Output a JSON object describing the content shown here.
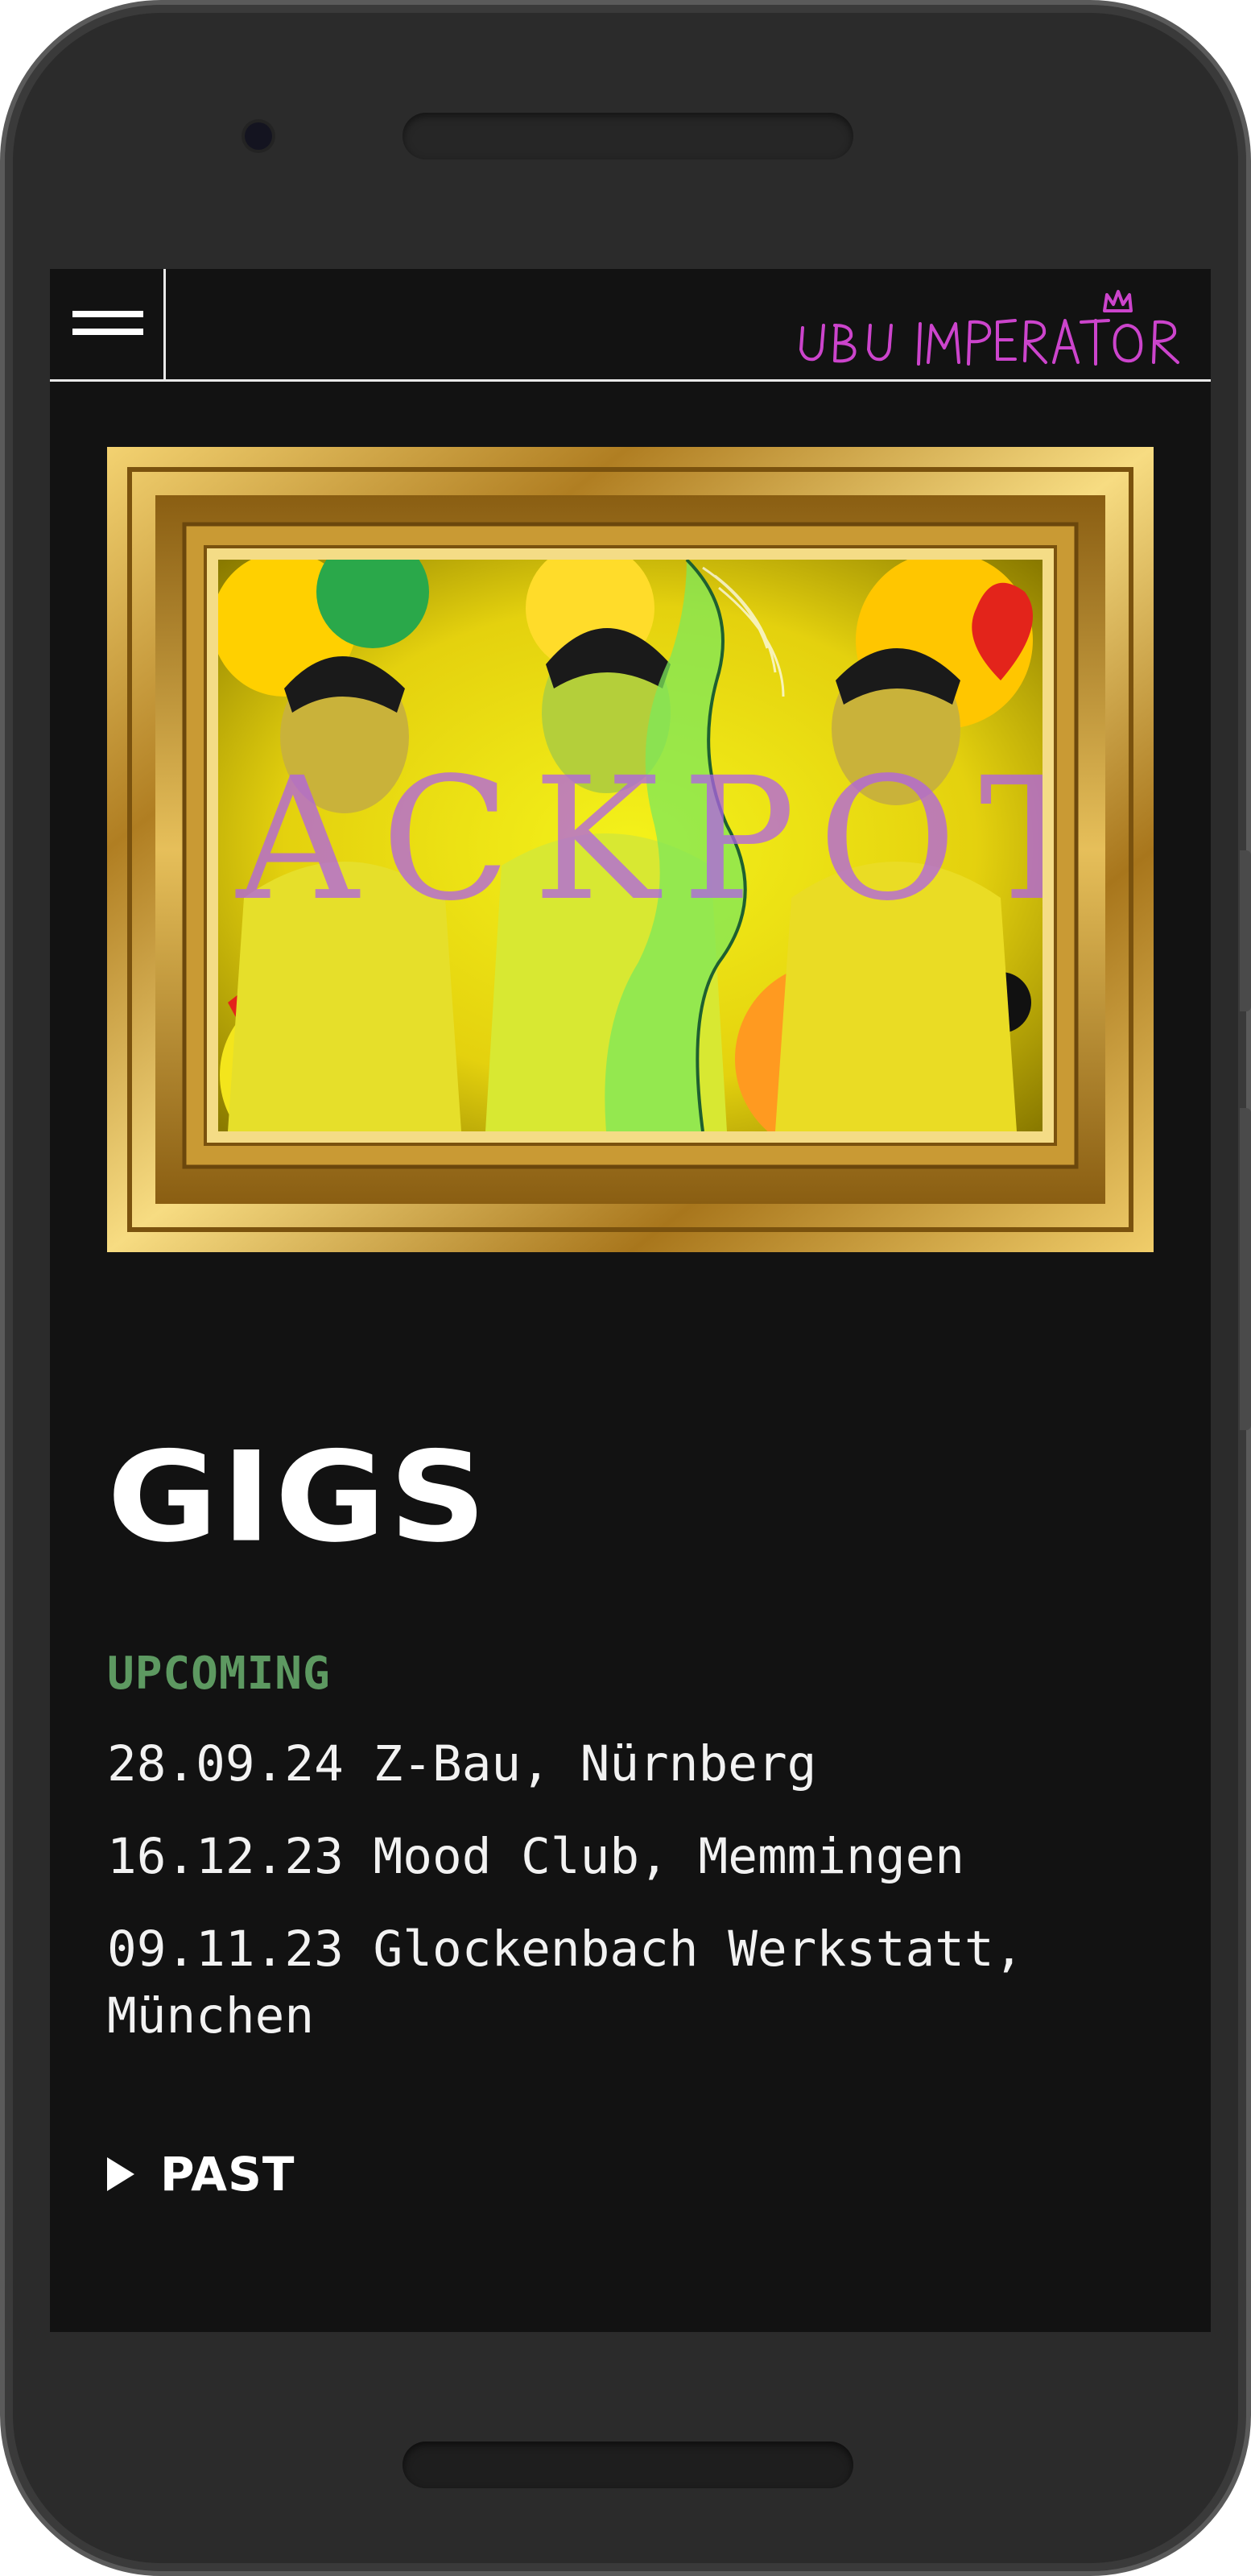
{
  "brand": {
    "logo_text": "UBU IMPERATOR",
    "logo_color": "#cc44cc"
  },
  "hero": {
    "overlay_text": "JACKPOT",
    "overlay_color": "#b060e8"
  },
  "gigs": {
    "title": "GIGS",
    "upcoming_label": "UPCOMING",
    "upcoming_color": "#5d9961",
    "items": [
      "28.09.24 Z-Bau, Nürnberg",
      "16.12.23 Mood Club, Memmingen",
      "09.11.23 Glockenbach Werkstatt, München"
    ],
    "past_label": "PAST"
  },
  "icons": {
    "menu": "hamburger-icon",
    "past_toggle": "triangle-right-icon"
  }
}
